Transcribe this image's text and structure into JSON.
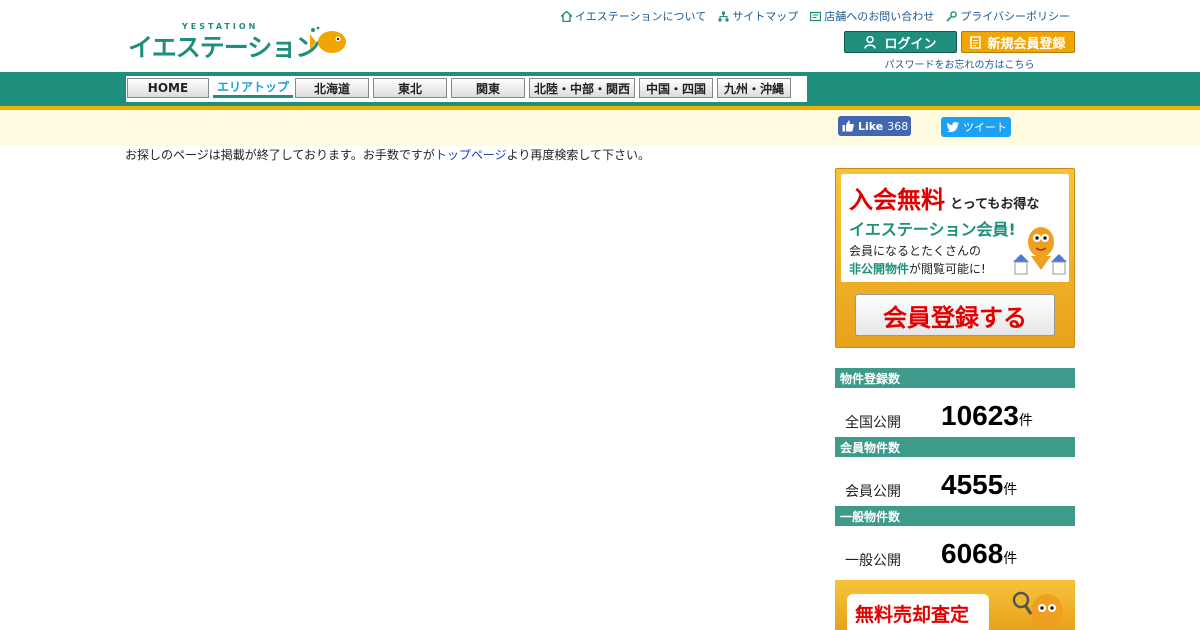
{
  "header": {
    "logo_main_a": "イエ",
    "logo_main_b": "ステーション",
    "logo_tag": "YESTATION",
    "links": [
      {
        "label": "イエステーションについて",
        "icon": "house-icon"
      },
      {
        "label": "サイトマップ",
        "icon": "sitemap-icon"
      },
      {
        "label": "店舗へのお問い合わせ",
        "icon": "contact-form-icon"
      },
      {
        "label": "プライバシーポリシー",
        "icon": "key-icon"
      }
    ],
    "login_label": "ログイン",
    "register_label": "新規会員登録",
    "forgot_password": "パスワードをお忘れの方はこちら"
  },
  "nav": {
    "items": [
      {
        "label": "HOME",
        "active": false
      },
      {
        "label": "エリアトップ",
        "active": true
      },
      {
        "label": "北海道",
        "active": false
      },
      {
        "label": "東北",
        "active": false
      },
      {
        "label": "関東",
        "active": false
      },
      {
        "label": "北陸・中部・関西",
        "active": false
      },
      {
        "label": "中国・四国",
        "active": false
      },
      {
        "label": "九州・沖縄",
        "active": false
      }
    ]
  },
  "social": {
    "facebook_label": "Like",
    "facebook_count": "368",
    "twitter_label": "ツイート"
  },
  "main": {
    "message_before": "お探しのページは掲載が終了しております。お手数ですが",
    "message_link": "トップページ",
    "message_after": "より再度検索して下さい。"
  },
  "sidebar": {
    "banner": {
      "free_label": "入会無料",
      "catch": "とってもお得な",
      "member_title": "イエステーション会員!",
      "line3": "会員になるとたくさんの",
      "line4_highlight": "非公開物件",
      "line4_rest": "が閲覧可能に!",
      "cta": "会員登録する"
    },
    "stats": [
      {
        "heading": "物件登録数",
        "label": "全国公開",
        "value": "10623",
        "unit": "件"
      },
      {
        "heading": "会員物件数",
        "label": "会員公開",
        "value": "4555",
        "unit": "件"
      },
      {
        "heading": "一般物件数",
        "label": "一般公開",
        "value": "6068",
        "unit": "件"
      }
    ],
    "banner2_text": "無料売却査定"
  },
  "colors": {
    "brand_green": "#1e8f7c",
    "brand_orange": "#f0a500",
    "alert_red": "#e00000"
  }
}
